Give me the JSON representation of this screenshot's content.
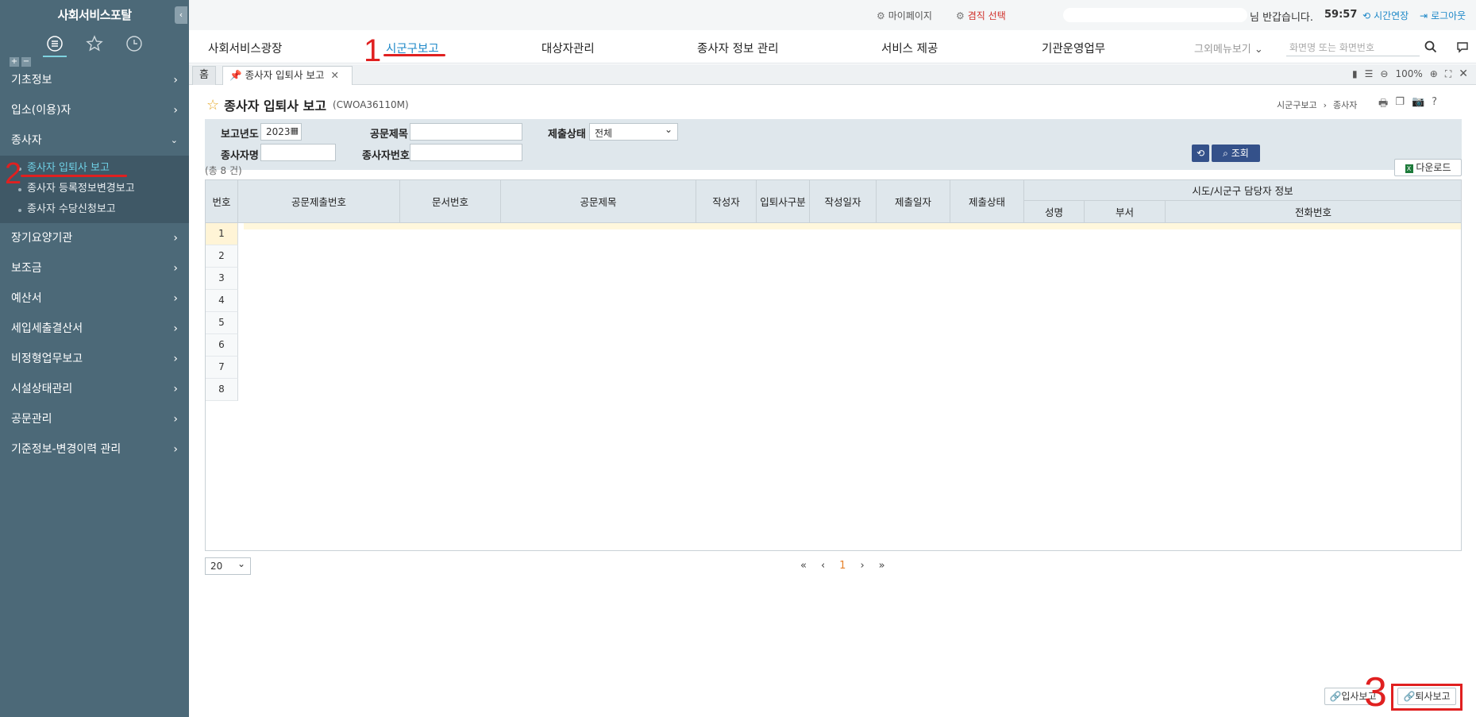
{
  "sidebar": {
    "brand": "사회서비스포탈",
    "menu": [
      {
        "label": "기초정보"
      },
      {
        "label": "입소(이용)자"
      },
      {
        "label": "종사자",
        "expanded": true
      },
      {
        "label": "장기요양기관"
      },
      {
        "label": "보조금"
      },
      {
        "label": "예산서"
      },
      {
        "label": "세입세출결산서"
      },
      {
        "label": "비정형업무보고"
      },
      {
        "label": "시설상태관리"
      },
      {
        "label": "공문관리"
      },
      {
        "label": "기준정보-변경이력 관리"
      }
    ],
    "submenu": [
      {
        "label": "종사자 입퇴사 보고",
        "active": true
      },
      {
        "label": "종사자 등록정보변경보고"
      },
      {
        "label": "종사자 수당신청보고"
      }
    ]
  },
  "topbar": {
    "mypage": "마이페이지",
    "duty": "겸직 선택",
    "greeting": "님 반갑습니다.",
    "timer": "59:57",
    "extend": "시간연장",
    "logout": "로그아웃"
  },
  "mainnav": {
    "items": [
      "사회서비스광장",
      "시군구보고",
      "대상자관리",
      "종사자 정보 관리",
      "서비스 제공",
      "기관운영업무"
    ],
    "more": "그외메뉴보기",
    "search_placeholder": "화면명 또는 화면번호"
  },
  "tabs": {
    "home": "홈",
    "current": "종사자 입퇴사 보고",
    "zoom": "100%"
  },
  "page": {
    "title": "종사자 입퇴사 보고",
    "code": "(CWOA36110M)",
    "breadcrumb": [
      "시군구보고",
      "종사자"
    ]
  },
  "search": {
    "year_label": "보고년도",
    "year_value": "2023",
    "title_label": "공문제목",
    "status_label": "제출상태",
    "status_value": "전체",
    "name_label": "종사자명",
    "number_label": "종사자번호",
    "search_btn": "조회"
  },
  "grid": {
    "count": "(총 8 건)",
    "download": "다운로드",
    "columns": [
      "번호",
      "공문제출번호",
      "문서번호",
      "공문제목",
      "작성자",
      "입퇴사구분",
      "작성일자",
      "제출일자",
      "제출상태"
    ],
    "group_header": "시도/시군구 담당자 정보",
    "group_columns": [
      "성명",
      "부서",
      "전화번호"
    ],
    "rows": [
      "1",
      "2",
      "3",
      "4",
      "5",
      "6",
      "7",
      "8"
    ],
    "page_size": "20",
    "current_page": "1"
  },
  "actions": {
    "join_report": "입사보고",
    "leave_report": "퇴사보고"
  },
  "annotations": [
    "1",
    "2",
    "3"
  ]
}
